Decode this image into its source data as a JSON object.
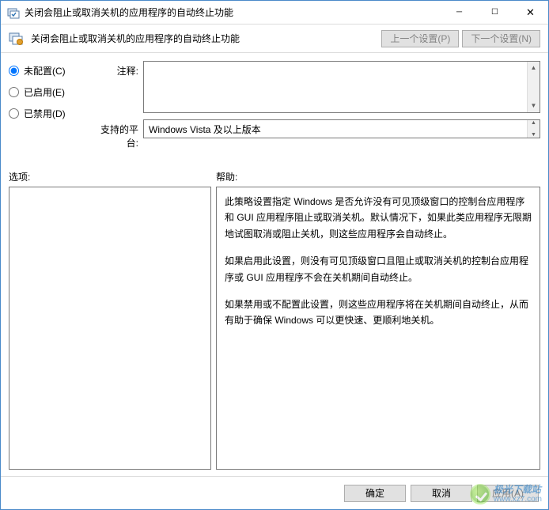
{
  "title": "关闭会阻止或取消关机的应用程序的自动终止功能",
  "toolbar": {
    "heading": "关闭会阻止或取消关机的应用程序的自动终止功能",
    "prev_label": "上一个设置(P)",
    "next_label": "下一个设置(N)"
  },
  "config": {
    "radios": {
      "not_configured": "未配置(C)",
      "enabled": "已启用(E)",
      "disabled": "已禁用(D)",
      "selected": "not_configured"
    },
    "comment_label": "注释:",
    "comment_value": "",
    "platform_label": "支持的平台:",
    "platform_value": "Windows Vista 及以上版本"
  },
  "sections": {
    "options_label": "选项:",
    "help_label": "帮助:"
  },
  "help": {
    "p1": "此策略设置指定 Windows 是否允许没有可见顶级窗口的控制台应用程序和 GUI 应用程序阻止或取消关机。默认情况下，如果此类应用程序无限期地试图取消或阻止关机，则这些应用程序会自动终止。",
    "p2": "如果启用此设置，则没有可见顶级窗口且阻止或取消关机的控制台应用程序或 GUI 应用程序不会在关机期间自动终止。",
    "p3": "如果禁用或不配置此设置，则这些应用程序将在关机期间自动终止，从而有助于确保 Windows 可以更快速、更顺利地关机。"
  },
  "footer": {
    "ok": "确定",
    "cancel": "取消",
    "apply": "应用(A)"
  },
  "watermark": {
    "name": "极光下载站",
    "url": "www.xz7.com"
  }
}
